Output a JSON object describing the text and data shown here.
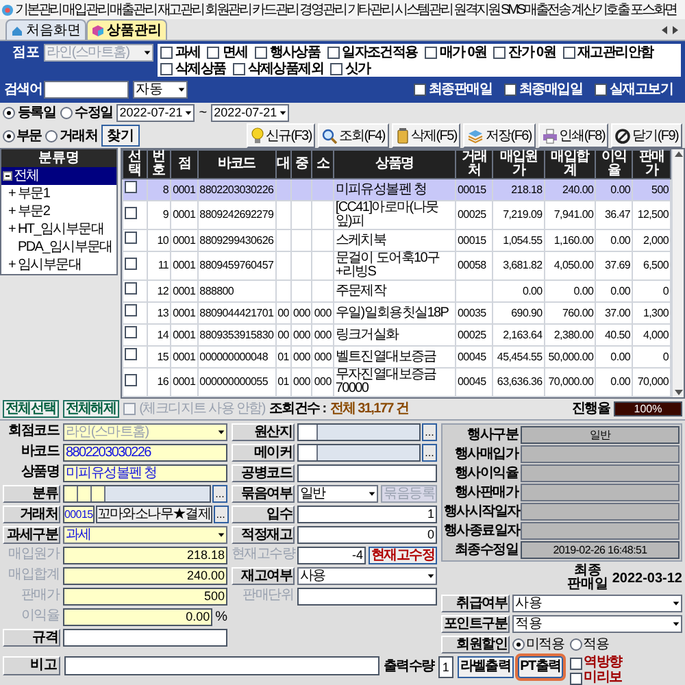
{
  "menu_bar": {
    "items": [
      "기본관리",
      "매입관리",
      "매출관리",
      "재고관리",
      "회원관리",
      "카드관리",
      "경영관리",
      "기타관리",
      "시스템관리",
      "원격지원",
      "SMS매출전송",
      "계산기호출",
      "포스화면"
    ]
  },
  "tabs": [
    {
      "label": "처음화면",
      "selected": false
    },
    {
      "label": "상품관리",
      "selected": true
    }
  ],
  "filter": {
    "store_label": "점포",
    "store_value": "라인(스마트홈)",
    "store_disabled": true,
    "flags": [
      {
        "label": "과세",
        "checked": false
      },
      {
        "label": "면세",
        "checked": false
      },
      {
        "label": "행사상품",
        "checked": false
      },
      {
        "label": "일자조건적용",
        "checked": false
      },
      {
        "label": "매가 0원",
        "checked": false
      },
      {
        "label": "잔가 0원",
        "checked": false
      },
      {
        "label": "재고관리안함",
        "checked": false
      },
      {
        "label": "삭제상품",
        "checked": false
      },
      {
        "label": "삭제상품제외",
        "checked": false
      },
      {
        "label": "싯가",
        "checked": false
      }
    ],
    "search_label": "검색어",
    "search_mode": "자동",
    "date_options": [
      {
        "label": "최종판매일",
        "checked": false
      },
      {
        "label": "최종매입일",
        "checked": false
      },
      {
        "label": "실재고보기",
        "checked": false
      }
    ]
  },
  "date_range": {
    "modes": [
      {
        "label": "등록일",
        "selected": true
      },
      {
        "label": "수정일",
        "selected": false
      }
    ],
    "from": "2022-07-21",
    "separator": "~",
    "to": "2022-07-21"
  },
  "group_by": {
    "modes": [
      {
        "label": "부문",
        "selected": true
      },
      {
        "label": "거래처",
        "selected": false
      }
    ],
    "find_button": "찾기"
  },
  "toolbar": [
    "신규(F3)",
    "조회(F4)",
    "삭제(F5)",
    "저장(F6)",
    "인쇄(F8)",
    "닫기(F9)"
  ],
  "tree": {
    "header": "분류명",
    "items": [
      {
        "label": "전체",
        "selected": true,
        "expanded": true,
        "children": [
          {
            "label": "부문1",
            "toggle": "+",
            "selected": false
          },
          {
            "label": "부문2",
            "toggle": "+",
            "selected": false
          },
          {
            "label": "HT_임시부문대",
            "toggle": "+",
            "selected": false
          },
          {
            "label": "PDA_임시부문대",
            "selected": false
          },
          {
            "label": "임시부문대",
            "toggle": "+",
            "selected": false
          }
        ]
      }
    ]
  },
  "table": {
    "columns": [
      "선택",
      "번호",
      "점",
      "바코드",
      "대",
      "중",
      "소",
      "상품명",
      "거래처",
      "매입원가",
      "매입합계",
      "이익율",
      "판매가"
    ],
    "rows": [
      {
        "selected": true,
        "checked": false,
        "cells": [
          null,
          "8",
          "0001",
          "8802203030226",
          null,
          null,
          null,
          "미피유성볼펜 청",
          "00015",
          "218.18",
          "240.00",
          "0.00",
          "500"
        ]
      },
      {
        "selected": false,
        "checked": false,
        "cells": [
          null,
          "9",
          "0001",
          "8809242692279",
          null,
          null,
          null,
          "[CC41]아로마(나뭇잎)피",
          "00025",
          "7,219.09",
          "7,941.00",
          "36.47",
          "12,500"
        ]
      },
      {
        "selected": false,
        "checked": false,
        "cells": [
          null,
          "10",
          "0001",
          "8809299430626",
          null,
          null,
          null,
          "스케치북",
          "00015",
          "1,054.55",
          "1,160.00",
          "0.00",
          "2,000"
        ]
      },
      {
        "selected": false,
        "checked": false,
        "cells": [
          null,
          "11",
          "0001",
          "8809459760457",
          null,
          null,
          null,
          "문걸이 도어훅10구+리빙S",
          "00058",
          "3,681.82",
          "4,050.00",
          "37.69",
          "6,500"
        ]
      },
      {
        "selected": false,
        "checked": false,
        "cells": [
          null,
          "12",
          "0001",
          "888800",
          null,
          null,
          null,
          "주문제작",
          null,
          "0.00",
          "0.00",
          "0.00",
          "0"
        ]
      },
      {
        "selected": false,
        "checked": false,
        "cells": [
          null,
          "13",
          "0001",
          "8809044421701",
          "00",
          "000",
          "000",
          "우일)일회용칫실18P",
          "00035",
          "690.90",
          "760.00",
          "37.00",
          "1,300"
        ]
      },
      {
        "selected": false,
        "checked": false,
        "cells": [
          null,
          "14",
          "0001",
          "8809353915830",
          "00",
          "000",
          "000",
          "링크거실화",
          "00025",
          "2,163.64",
          "2,380.00",
          "40.50",
          "4,000"
        ]
      },
      {
        "selected": false,
        "checked": false,
        "cells": [
          null,
          "15",
          "0001",
          "000000000048",
          "01",
          "000",
          "000",
          "벨트진열대보증금",
          "00045",
          "45,454.55",
          "50,000.00",
          "0.00",
          "0"
        ]
      },
      {
        "selected": false,
        "checked": false,
        "cells": [
          null,
          "16",
          "0001",
          "000000000055",
          "01",
          "000",
          "000",
          "무자진열대보증금70000",
          "00045",
          "63,636.36",
          "70,000.00",
          "0.00",
          "70,000"
        ]
      }
    ]
  },
  "table_actions": {
    "select_all": "전체선택",
    "deselect_all": "전체해제",
    "check_digit": {
      "label": "(체크디지트 사용 안함)",
      "checked": false,
      "disabled": true
    },
    "count_label": "조회건수 :",
    "count_value": "전체 31,177 건",
    "progress_label": "진행율",
    "progress": {
      "level": 1,
      "reading": "100%"
    }
  },
  "form": {
    "left": [
      {
        "label": "회점코드",
        "label_raised": false,
        "label_disabled": false,
        "kind": "select",
        "value": "라인(스마트홈)",
        "disabled": true,
        "emphasized": false,
        "tinted": true
      },
      {
        "label": "바코드",
        "label_raised": false,
        "label_disabled": false,
        "kind": "text",
        "value": "8802203030226",
        "emphasized": true,
        "tinted": true
      },
      {
        "label": "상품명",
        "label_raised": false,
        "label_disabled": false,
        "kind": "text",
        "value": "미피유성볼펜 청",
        "emphasized": true,
        "tinted": true
      },
      {
        "label": "분류",
        "label_raised": true,
        "label_disabled": false,
        "kind": "category",
        "button": "...",
        "tinted": true
      },
      {
        "label": "거래처",
        "label_raised": true,
        "label_disabled": false,
        "kind": "vendor",
        "code": "00015",
        "value": "꼬마와소나무★결제",
        "button": "...",
        "emphasized": true,
        "tinted": true
      },
      {
        "label": "과세구분",
        "label_raised": true,
        "label_disabled": false,
        "kind": "select",
        "value": "과세",
        "emphasized": true,
        "tinted": true
      },
      {
        "label": "매입원가",
        "label_raised": false,
        "label_disabled": true,
        "kind": "number",
        "value": "218.18",
        "tinted": true
      },
      {
        "label": "매입합계",
        "label_raised": false,
        "label_disabled": true,
        "kind": "number",
        "value": "240.00",
        "tinted": true
      },
      {
        "label": "판매가",
        "label_raised": false,
        "label_disabled": true,
        "kind": "number",
        "value": "500",
        "tinted": true
      },
      {
        "label": "이익율",
        "label_raised": false,
        "label_disabled": true,
        "kind": "number",
        "value": "0.00",
        "suffix": "%",
        "tinted": true
      },
      {
        "label": "규격",
        "label_raised": true,
        "label_disabled": false,
        "kind": "text",
        "tinted": false
      }
    ],
    "middle": [
      {
        "label": "원산지",
        "label_raised": true,
        "label_disabled": false,
        "kind": "pair",
        "button": "..."
      },
      {
        "label": "메이커",
        "label_raised": true,
        "label_disabled": false,
        "kind": "pair",
        "button": "..."
      },
      {
        "label": "공병코드",
        "label_raised": true,
        "label_disabled": false,
        "kind": "text"
      },
      {
        "label": "묶음여부",
        "label_raised": true,
        "label_disabled": false,
        "kind": "select",
        "value": "일반",
        "action": {
          "label": "묶음등록",
          "disabled": true
        }
      },
      {
        "label": "입수",
        "label_raised": true,
        "label_disabled": false,
        "kind": "number",
        "value": "1"
      },
      {
        "label": "적정재고",
        "label_raised": true,
        "label_disabled": false,
        "kind": "number",
        "value": "0"
      },
      {
        "label": "현재고수량",
        "label_raised": false,
        "label_disabled": true,
        "kind": "number",
        "value": "-4",
        "action": {
          "label": "현재고수정",
          "disabled": false
        }
      },
      {
        "label": "재고여부",
        "label_raised": true,
        "label_disabled": false,
        "kind": "select",
        "value": "사용"
      },
      {
        "label": "판매단위",
        "label_raised": false,
        "label_disabled": true,
        "kind": "text"
      }
    ],
    "event_panel": [
      {
        "label": "행사구분",
        "value": "일반"
      },
      {
        "label": "행사매입가"
      },
      {
        "label": "행사이익율"
      },
      {
        "label": "행사판매가"
      },
      {
        "label": "행사시작일자"
      },
      {
        "label": "행사종료일자"
      },
      {
        "label": "최종수정일",
        "value": "2019-02-26 16:48:51"
      }
    ],
    "last_sale": {
      "label": "최종 판매일",
      "value": "2022-03-12"
    },
    "right": [
      {
        "label": "취급여부",
        "kind": "select",
        "value": "사용"
      },
      {
        "label": "포인트구분",
        "kind": "select",
        "value": "적용"
      },
      {
        "label": "회원할인",
        "kind": "radio",
        "options": [
          {
            "label": "미적용",
            "selected": true
          },
          {
            "label": "적용",
            "selected": false
          }
        ]
      }
    ],
    "remark_label": "비고",
    "print": {
      "quantity_label": "출력수량",
      "quantity": "1",
      "buttons": [
        {
          "label": "라벨출력",
          "highlighted": false
        },
        {
          "label": "PT출력",
          "highlighted": true
        }
      ],
      "options": [
        {
          "label": "역방향",
          "checked": false
        },
        {
          "label": "미리보",
          "checked": false
        }
      ]
    }
  }
}
